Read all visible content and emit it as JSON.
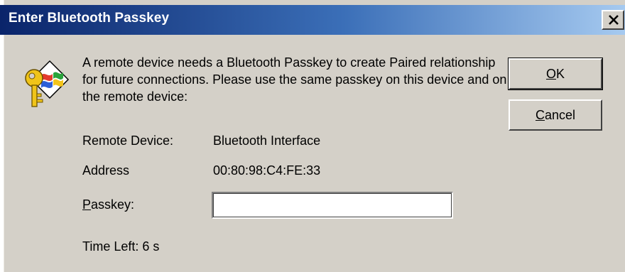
{
  "window": {
    "title": "Enter Bluetooth Passkey",
    "close_label": "X"
  },
  "icons": {
    "dialog_icon": "bluetooth-key-icon",
    "close_icon": "close-icon"
  },
  "message": "A remote device needs a Bluetooth Passkey to create Paired relationship for future connections. Please use the same passkey on this device and on the remote device:",
  "fields": {
    "remote_device_label": "Remote Device:",
    "remote_device_value": "Bluetooth Interface",
    "address_label": "Address",
    "address_value": "00:80:98:C4:FE:33",
    "passkey_label_first": "P",
    "passkey_label_rest": "asskey:",
    "passkey_value": "",
    "time_left": "Time Left: 6 s"
  },
  "buttons": {
    "ok_first": "O",
    "ok_rest": "K",
    "cancel_first": "C",
    "cancel_rest": "ancel"
  }
}
